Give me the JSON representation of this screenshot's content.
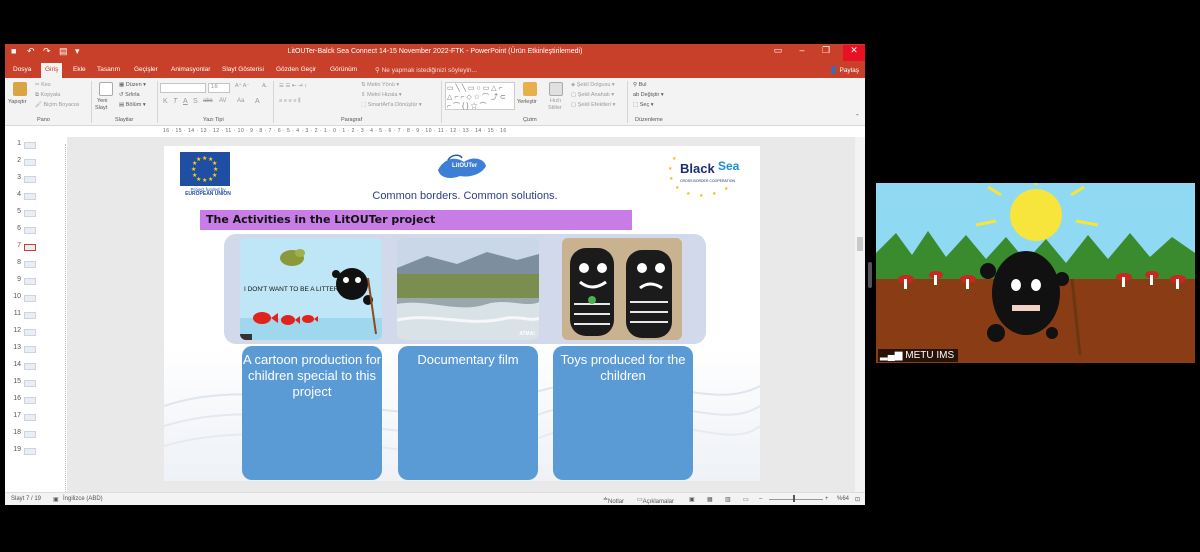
{
  "window": {
    "title": "LitOUTer-Balck Sea Connect 14-15 November 2022-FTK - PowerPoint (Ürün Etkinleştirilemedi)",
    "share_label": "Paylaş",
    "tell_me_placeholder": "Ne yapmak istediğinizi söyleyin..."
  },
  "tabs": [
    "Dosya",
    "Giriş",
    "Ekle",
    "Tasarım",
    "Geçişler",
    "Animasyonlar",
    "Slayt Gösterisi",
    "Gözden Geçir",
    "Görünüm"
  ],
  "active_tab": "Giriş",
  "ribbon": {
    "groups": [
      "Pano",
      "Slaytlar",
      "Yazı Tipi",
      "Paragraf",
      "Çizim",
      "Düzenleme"
    ],
    "clipboard": {
      "paste": "Yapıştır",
      "cut": "Kes",
      "copy": "Kopyala",
      "format_painter": "Biçim Boyacısı"
    },
    "slides": {
      "new_slide_1": "Yeni",
      "new_slide_2": "Slayt",
      "layout": "Düzen",
      "reset": "Sıfırla",
      "section": "Bölüm"
    },
    "font": {
      "size": "16",
      "bold": "K",
      "italic": "T",
      "underline": "A",
      "shadow": "S",
      "strike": "abc",
      "spacing": "AV",
      "case": "Aa",
      "color": "A"
    },
    "paragraph": {
      "text_direction": "Metin Yönü",
      "align_text": "Metni Hizala",
      "smartart": "SmartArt'a Dönüştür"
    },
    "drawing": {
      "arrange": "Yerleştir",
      "quick_styles_1": "Hızlı",
      "quick_styles_2": "Stiller",
      "shape_fill": "Şekil Dolgusu",
      "shape_outline": "Şekil Anahatı",
      "shape_effects": "Şekil Efektleri"
    },
    "editing": {
      "find": "Bul",
      "replace": "Değiştir",
      "select": "Seç"
    }
  },
  "ruler_text": "16 · 15 · 14 · 13 · 12 · 11 · 10 · 9 · 8 · 7 · 6 · 5 · 4 · 3 · 2 · 1 · 0 · 1 · 2 · 3 · 4 · 5 · 6 · 7 · 8 · 9 · 10 · 11 · 12 · 13 · 14 · 15 · 16",
  "thumbnails": [
    "1",
    "2",
    "3",
    "4",
    "5",
    "6",
    "7",
    "8",
    "9",
    "10",
    "11",
    "12",
    "13",
    "14",
    "15",
    "16",
    "17",
    "18",
    "19"
  ],
  "active_slide": "7",
  "slide": {
    "eu_caption_line1": "Project funded by",
    "eu_caption_line2": "EUROPEAN UNION",
    "litouter_logo": "LitOUTer",
    "slogan": "Common borders. Common solutions.",
    "blacksea_logo_1": "Black",
    "blacksea_logo_2": "Sea",
    "blacksea_sub": "CROSS BORDER COOPERATION",
    "heading": "The Activities in the LitOUTer project",
    "cartoon_text": "I DON'T WANT TO BE A LITTER",
    "film_badge": "ATMA!",
    "activities": [
      {
        "label": "A cartoon production for children special to this project"
      },
      {
        "label": "Documentary film"
      },
      {
        "label": "Toys produced for the children"
      }
    ]
  },
  "status": {
    "slide_count": "Slayt 7 / 19",
    "language": "İngilizce (ABD)",
    "notes": "Notlar",
    "comments": "Açıklamalar",
    "zoom": "%64"
  },
  "video": {
    "participant": "METU IMS"
  },
  "colors": {
    "accent": "#c8402a",
    "heading_bg": "#c87ce6",
    "card_bg": "#5b9bd5",
    "panel_bg": "#d2d9ea"
  }
}
